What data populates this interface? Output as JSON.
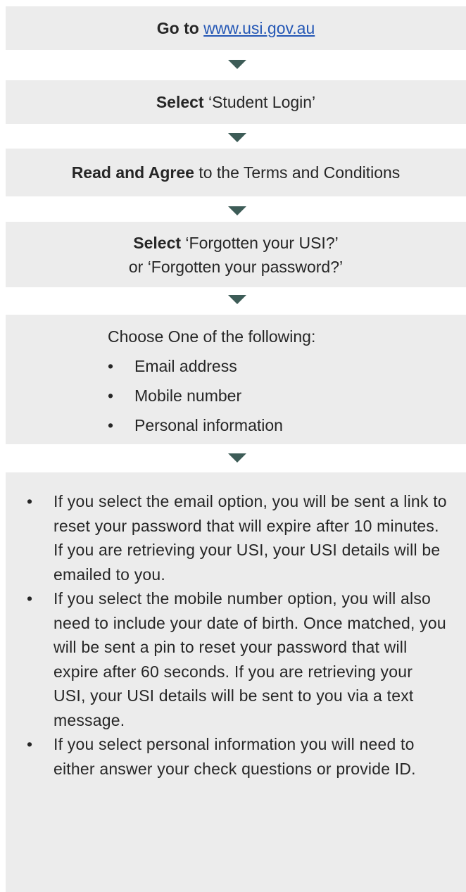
{
  "steps": {
    "step1": {
      "bold": "Go to",
      "link": "www.usi.gov.au"
    },
    "step2": {
      "bold": "Select",
      "text": " ‘Student Login’"
    },
    "step3": {
      "bold": "Read and Agree",
      "text": " to the Terms and Conditions"
    },
    "step4": {
      "bold": "Select",
      "text": " ‘Forgotten your USI?’",
      "line2": "or ‘Forgotten your password?’"
    },
    "step5": {
      "heading": "Choose One of the following:",
      "options": [
        "Email address",
        "Mobile number",
        "Personal information"
      ]
    }
  },
  "notes": [
    "If you select the email option, you will be sent a link to reset your password that will expire after 10 minutes. If you are retrieving your USI, your USI details will be emailed to you.",
    "If you select the mobile number option, you will also need to include your date of birth. Once matched, you will be sent a pin to reset your password that will expire after 60 seconds. If you are retrieving your USI, your USI details will be sent to you via a text message.",
    "If you select personal information you will need to either answer your check questions or provide ID."
  ],
  "colors": {
    "box_background": "#ececec",
    "arrow": "#3d5c57",
    "link": "#2457b5",
    "text": "#262626"
  },
  "icons": [
    "down-arrow-icon",
    "bullet-icon"
  ]
}
